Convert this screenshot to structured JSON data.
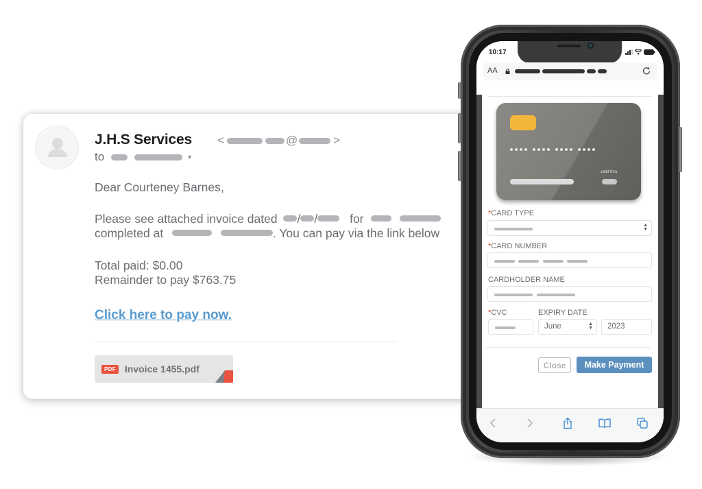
{
  "email": {
    "sender_name": "J.H.S Services",
    "sender_email_open": "<",
    "sender_email_at": "@",
    "sender_email_close": ">",
    "to_label": "to",
    "greeting": "Dear Courteney Barnes,",
    "paragraph_line1_prefix": "Please see attached invoice dated",
    "date_sep": "/",
    "paragraph_line1_for": "for",
    "paragraph_line2_prefix": "completed at",
    "paragraph_line2_suffix": ". You can pay via the link below",
    "total_paid": "Total paid: $0.00",
    "remainder": "Remainder to pay $763.75",
    "pay_link": "Click here to pay now.",
    "attachment": {
      "badge": "PDF",
      "filename": "Invoice 1455.pdf"
    }
  },
  "phone": {
    "status_time": "10:17",
    "address_bar": {
      "text_size_label": "AA",
      "icons": [
        "lock-icon",
        "reload-icon"
      ]
    },
    "card_preview": {
      "valid_thru_label": "valid thru"
    },
    "form": {
      "card_type": {
        "label": "CARD TYPE",
        "required": "*"
      },
      "card_number": {
        "label": "CARD NUMBER",
        "required": "*"
      },
      "cardholder_name": {
        "label": "CARDHOLDER NAME"
      },
      "cvc": {
        "label": "CVC",
        "required": "*"
      },
      "expiry": {
        "label": "EXPIRY DATE",
        "month": "June",
        "year": "2023"
      },
      "close_label": "Close",
      "submit_label": "Make Payment"
    },
    "toolbar": [
      "back-icon",
      "forward-icon",
      "share-icon",
      "bookmarks-icon",
      "tabs-icon"
    ]
  },
  "colors": {
    "link": "#5a9bd0",
    "primary_button": "#5b8fbd",
    "pdf_badge": "#e8523f",
    "card_chip": "#f2b63a",
    "required_marker": "#d9342b"
  }
}
